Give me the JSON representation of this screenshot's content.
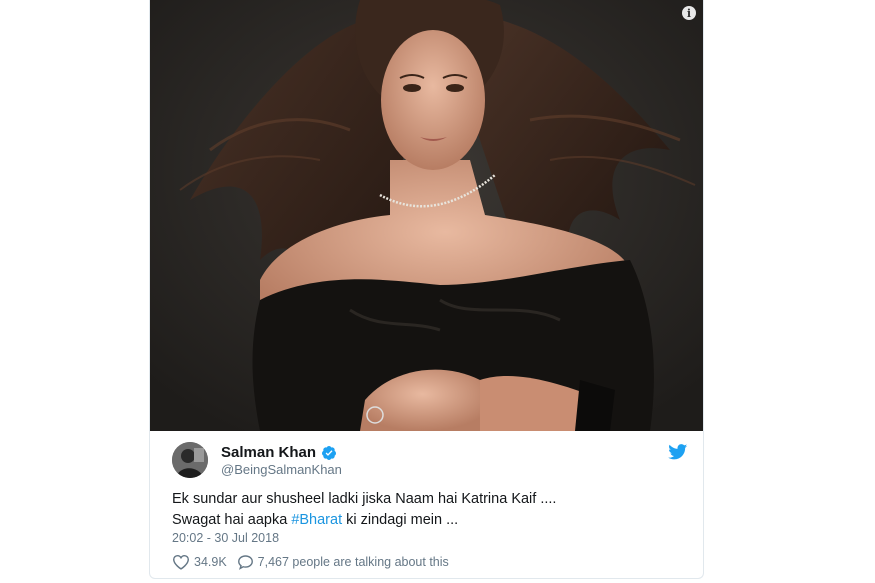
{
  "media": {
    "info_icon": "info-icon"
  },
  "tweet": {
    "display_name": "Salman Khan",
    "handle": "@BeingSalmanKhan",
    "text_before_tag": "Ek sundar aur shusheel ladki jiska Naam hai Katrina Kaif ....",
    "text_line2_start": "Swagat hai aapka ",
    "hashtag": "#Bharat",
    "text_line2_end": " ki zindagi mein ...",
    "timestamp": "20:02 - 30 Jul 2018",
    "likes": "34.9K",
    "talking": "7,467 people are talking about this"
  },
  "icons": {
    "verified": "verified-badge-icon",
    "twitter": "twitter-bird-icon",
    "like": "heart-icon",
    "reply": "speech-bubble-icon"
  },
  "colors": {
    "accent": "#1da1f2",
    "hashtag": "#1b95e0",
    "muted": "#657786",
    "text": "#14171a"
  }
}
